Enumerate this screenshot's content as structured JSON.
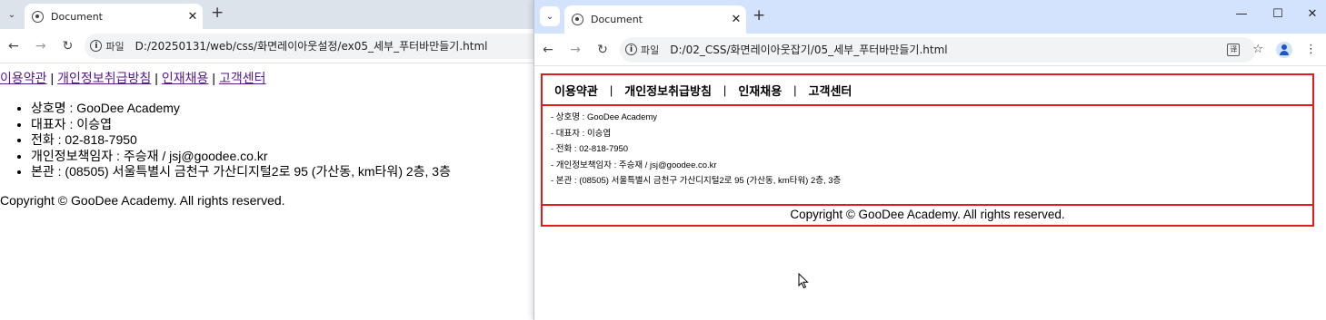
{
  "left_window": {
    "tab_dropdown": "⌄",
    "tab_title": "Document",
    "tab_close": "✕",
    "new_tab": "+",
    "nav": {
      "back": "←",
      "forward": "→",
      "reload": "↻"
    },
    "omnibox": {
      "info": "i",
      "scheme": "파일",
      "url": "D:/20250131/web/css/화면레이아웃설정/ex05_세부_푸터바만들기.html"
    },
    "page": {
      "nav_links": [
        "이용약관",
        "개인정보취급방침",
        "인재채용",
        "고객센터"
      ],
      "separator": "|",
      "info_items": [
        "상호명 : GooDee Academy",
        "대표자 : 이승엽",
        "전화 : 02-818-7950",
        "개인정보책임자 : 주승재 / jsj@goodee.co.kr",
        "본관 : (08505) 서울특별시 금천구 가산디지털2로 95 (가산동, km타워) 2층, 3층"
      ],
      "copyright": "Copyright © GooDee Academy. All rights reserved."
    }
  },
  "right_window": {
    "tab_dropdown": "⌄",
    "tab_title": "Document",
    "tab_close": "✕",
    "new_tab": "+",
    "window_controls": {
      "minimize": "—",
      "maximize": "☐",
      "close": "✕"
    },
    "nav": {
      "back": "←",
      "forward": "→",
      "reload": "↻"
    },
    "omnibox": {
      "info": "i",
      "scheme": "파일",
      "url": "D:/02_CSS/화면레이아웃잡기/05_세부_푸터바만들기.html"
    },
    "toolbar_icons": {
      "translate": "译",
      "star": "☆",
      "menu": "⋮"
    },
    "page": {
      "nav_links": [
        "이용약관",
        "개인정보취급방침",
        "인재채용",
        "고객센터"
      ],
      "separator": "|",
      "info_items": [
        "- 상호명 : GooDee Academy",
        "- 대표자 : 이승엽",
        "- 전화 : 02-818-7950",
        "- 개인정보책임자 : 주승재 / jsj@goodee.co.kr",
        "- 본관 : (08505) 서울특별시 금천구 가산디지털2로 95 (가산동, km타워) 2층, 3층"
      ],
      "copyright": "Copyright © GooDee Academy. All rights reserved."
    }
  },
  "colors": {
    "footer_border": "#e41b1b",
    "visited_link": "#551a8b",
    "tabstrip_right": "#d3e3fd",
    "tabstrip_left": "#dde3ea"
  }
}
